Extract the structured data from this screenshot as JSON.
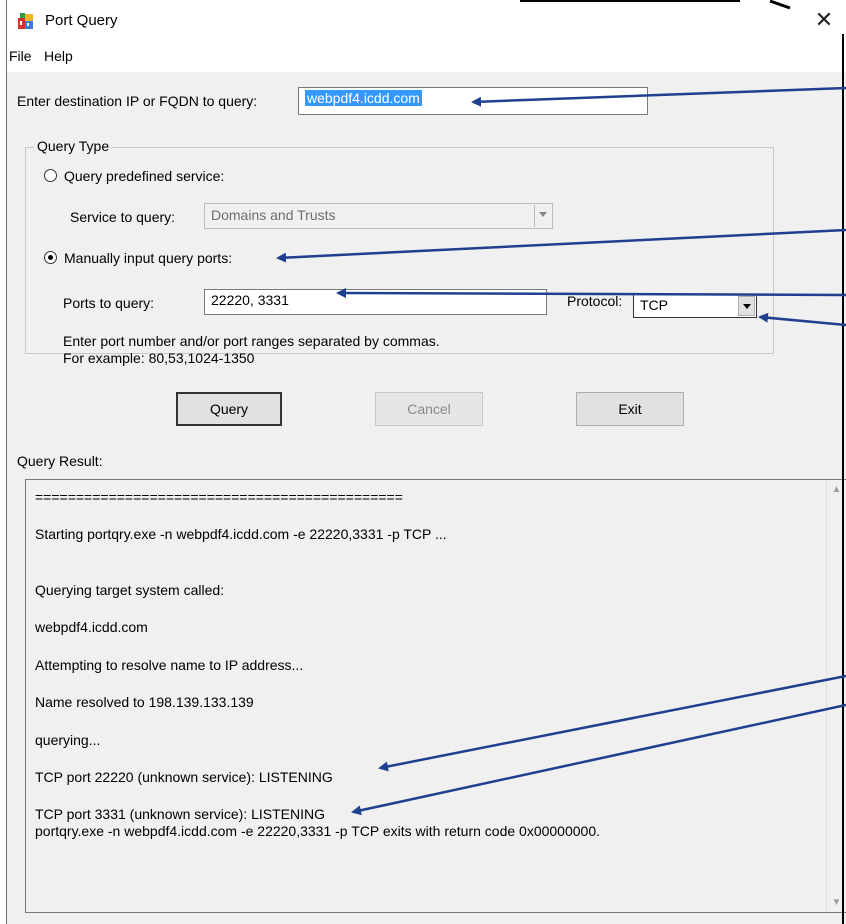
{
  "window": {
    "title": "Port Query",
    "close_glyph": "✕"
  },
  "menu": {
    "file": "File",
    "help": "Help"
  },
  "destination": {
    "label": "Enter destination IP or FQDN to query:",
    "value": "webpdf4.icdd.com"
  },
  "query_type": {
    "legend": "Query Type",
    "predefined_label": "Query predefined service:",
    "service_label": "Service to query:",
    "service_value": "Domains and Trusts",
    "manual_label": "Manually input query ports:",
    "ports_label": "Ports to query:",
    "ports_value": "22220, 3331",
    "protocol_label": "Protocol:",
    "protocol_value": "TCP",
    "hint_line1": "Enter port number and/or port ranges separated by commas.",
    "hint_line2": "For example: 80,53,1024-1350",
    "selected": "manual"
  },
  "buttons": {
    "query": "Query",
    "cancel": "Cancel",
    "exit": "Exit"
  },
  "result": {
    "label": "Query Result:",
    "lines": [
      "=============================================",
      " Starting portqry.exe -n webpdf4.icdd.com -e 22220,3331 -p TCP ...",
      "Querying target system called:",
      " webpdf4.icdd.com",
      "Attempting to resolve name to IP address...",
      "Name resolved to 198.139.133.139",
      "querying...",
      "TCP port 22220 (unknown service): LISTENING",
      "TCP port 3331 (unknown service): LISTENING",
      "portqry.exe -n webpdf4.icdd.com -e 22220,3331 -p TCP exits with return code 0x00000000."
    ]
  },
  "colors": {
    "annotation_arrow": "#1f3f8f",
    "selection": "#3399ff",
    "window_bg": "#f0f0f0"
  },
  "icons": {
    "app": "port-query-app-icon",
    "close": "close-icon",
    "dropdown": "chevron-down-icon",
    "scroll_up": "scroll-up-icon",
    "scroll_down": "scroll-down-icon"
  }
}
